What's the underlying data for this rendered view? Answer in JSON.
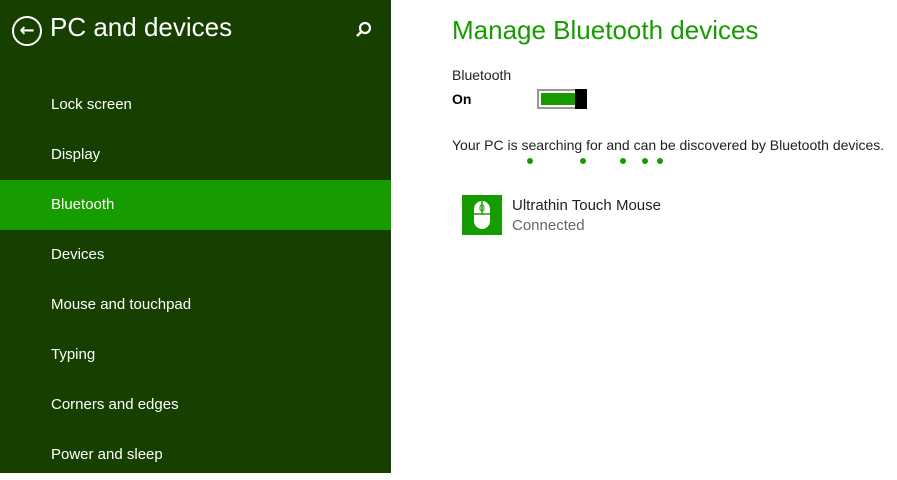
{
  "sidebar": {
    "title": "PC and devices",
    "items": [
      {
        "label": "Lock screen"
      },
      {
        "label": "Display"
      },
      {
        "label": "Bluetooth",
        "selected": true
      },
      {
        "label": "Devices"
      },
      {
        "label": "Mouse and touchpad"
      },
      {
        "label": "Typing"
      },
      {
        "label": "Corners and edges"
      },
      {
        "label": "Power and sleep"
      }
    ]
  },
  "main": {
    "title": "Manage Bluetooth devices",
    "bluetooth_label": "Bluetooth",
    "toggle_state": "On",
    "toggle_on": true,
    "status": "Your PC is searching for and can be discovered by Bluetooth devices.",
    "devices": [
      {
        "name": "Ultrathin Touch Mouse",
        "status": "Connected",
        "icon": "mouse-icon"
      }
    ]
  },
  "colors": {
    "accent": "#179c00",
    "sidebar": "#173f00"
  }
}
